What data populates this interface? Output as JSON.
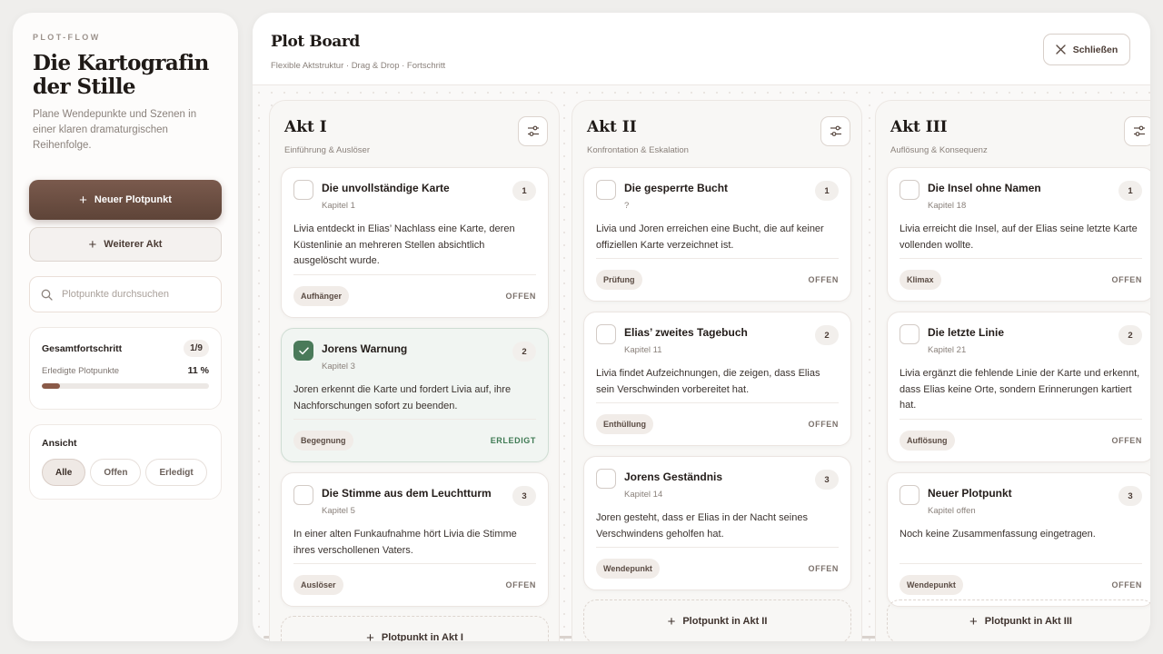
{
  "sidebar": {
    "eyebrow": "PLOT-FLOW",
    "title": "Die Kartografin der Stille",
    "description": "Plane Wendepunkte und Szenen in einer klaren dramaturgischen Reihenfolge.",
    "primary_button": "Neuer Plotpunkt",
    "secondary_button": "Weiterer Akt",
    "search_placeholder": "Plotpunkte durchsuchen",
    "progress": {
      "title": "Gesamtfortschritt",
      "count": "1/9",
      "label": "Erledigte Plotpunkte",
      "percent_text": "11 %",
      "fraction": 0.11
    },
    "view": {
      "title": "Ansicht",
      "filters": [
        "Alle",
        "Offen",
        "Erledigt"
      ],
      "active": "Alle"
    }
  },
  "main": {
    "title": "Plot Board",
    "subtitle": "Flexible Aktstruktur · Drag & Drop · Fortschritt",
    "close_label": "Schließen"
  },
  "columns": [
    {
      "title": "Akt I",
      "subtitle": "Einführung & Auslöser",
      "cards": [
        {
          "title": "Die unvollständige Karte",
          "chapter": "Kapitel 1",
          "num": "1",
          "text": "Livia entdeckt in Elias’ Nachlass eine Karte, deren Küstenlinie an mehreren Stellen absichtlich ausgelöscht wurde.",
          "tag": "Aufhänger",
          "status": "OFFEN",
          "done": false
        },
        {
          "title": "Jorens Warnung",
          "chapter": "Kapitel 3",
          "num": "2",
          "text": "Joren erkennt die Karte und fordert Livia auf, ihre Nachforschungen sofort zu beenden.",
          "tag": "Begegnung",
          "status": "ERLEDIGT",
          "done": true
        },
        {
          "title": "Die Stimme aus dem Leuchtturm",
          "chapter": "Kapitel 5",
          "num": "3",
          "text": "In einer alten Funkaufnahme hört Livia die Stimme ihres verschollenen Vaters.",
          "tag": "Auslöser",
          "status": "OFFEN",
          "done": false
        }
      ],
      "add_label": "Plotpunkt in Akt I"
    },
    {
      "title": "Akt II",
      "subtitle": "Konfrontation & Eskalation",
      "cards": [
        {
          "title": "Die gesperrte Bucht",
          "chapter": "?",
          "num": "1",
          "text": "Livia und Joren erreichen eine Bucht, die auf keiner offiziellen Karte verzeichnet ist.",
          "tag": "Prüfung",
          "status": "OFFEN",
          "done": false
        },
        {
          "title": "Elias’ zweites Tagebuch",
          "chapter": "Kapitel 11",
          "num": "2",
          "text": "Livia findet Aufzeichnungen, die zeigen, dass Elias sein Verschwinden vorbereitet hat.",
          "tag": "Enthüllung",
          "status": "OFFEN",
          "done": false
        },
        {
          "title": "Jorens Geständnis",
          "chapter": "Kapitel 14",
          "num": "3",
          "text": "Joren gesteht, dass er Elias in der Nacht seines Verschwindens geholfen hat.",
          "tag": "Wendepunkt",
          "status": "OFFEN",
          "done": false
        }
      ],
      "add_label": "Plotpunkt in Akt II"
    },
    {
      "title": "Akt III",
      "subtitle": "Auflösung & Konsequenz",
      "cards": [
        {
          "title": "Die Insel ohne Namen",
          "chapter": "Kapitel 18",
          "num": "1",
          "text": "Livia erreicht die Insel, auf der Elias seine letzte Karte vollenden wollte.",
          "tag": "Klimax",
          "status": "OFFEN",
          "done": false
        },
        {
          "title": "Die letzte Linie",
          "chapter": "Kapitel 21",
          "num": "2",
          "text": "Livia ergänzt die fehlende Linie der Karte und erkennt, dass Elias keine Orte, sondern Erinnerungen kartiert hat.",
          "tag": "Auflösung",
          "status": "OFFEN",
          "done": false
        },
        {
          "title": "Neuer Plotpunkt",
          "chapter": "Kapitel offen",
          "num": "3",
          "text": "Noch keine Zusammenfassung eingetragen.",
          "tag": "Wendepunkt",
          "status": "OFFEN",
          "done": false
        }
      ],
      "add_label": "Plotpunkt in Akt III"
    }
  ]
}
